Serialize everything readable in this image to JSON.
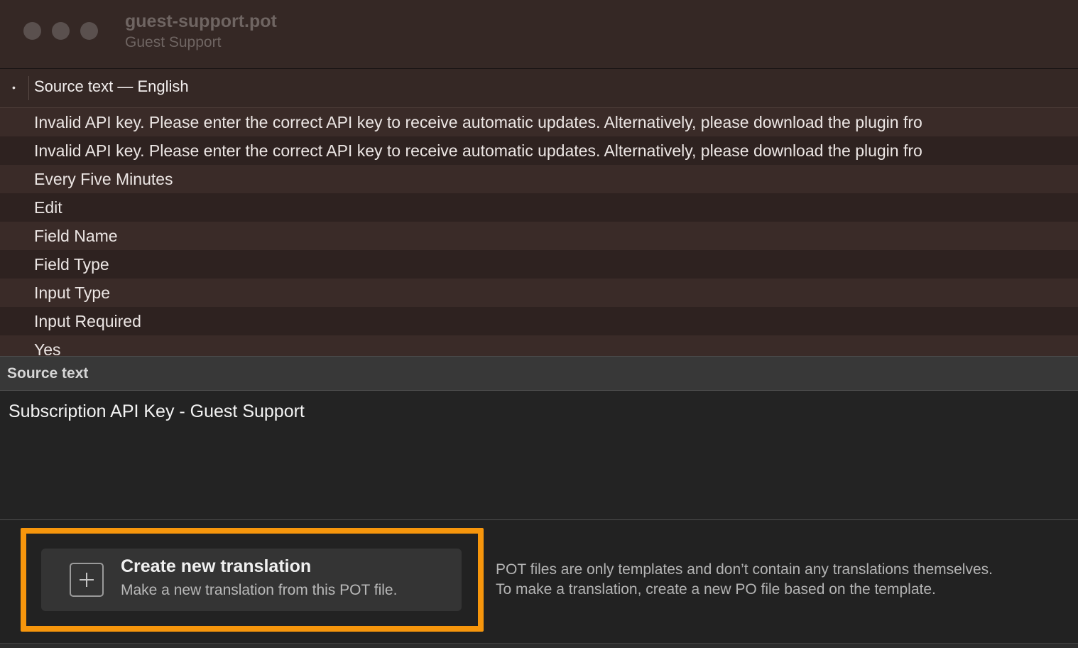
{
  "window": {
    "title": "guest-support.pot",
    "subtitle": "Guest Support"
  },
  "table": {
    "header_indicator": "•",
    "column_header": "Source text — English",
    "rows": [
      "Invalid API key. Please enter the correct API key to receive automatic updates. Alternatively, please download the plugin fro",
      "Invalid API key. Please enter the correct API key to receive automatic updates. Alternatively, please download the plugin fro",
      "Every Five Minutes",
      "Edit",
      "Field Name",
      "Field Type",
      "Input Type",
      "Input Required",
      "Yes"
    ]
  },
  "source_panel": {
    "header": "Source text",
    "text": "Subscription API Key - Guest Support"
  },
  "create_translation": {
    "title": "Create new translation",
    "subtitle": "Make a new translation from this POT file.",
    "highlight_color": "#f7960c"
  },
  "info": {
    "line1": "POT files are only templates and don’t contain any translations themselves.",
    "line2": "To make a translation, create a new PO file based on the template."
  },
  "icons": {
    "window_controls": [
      "close-icon",
      "minimize-icon",
      "zoom-icon"
    ],
    "create_icon": "plus-icon"
  }
}
